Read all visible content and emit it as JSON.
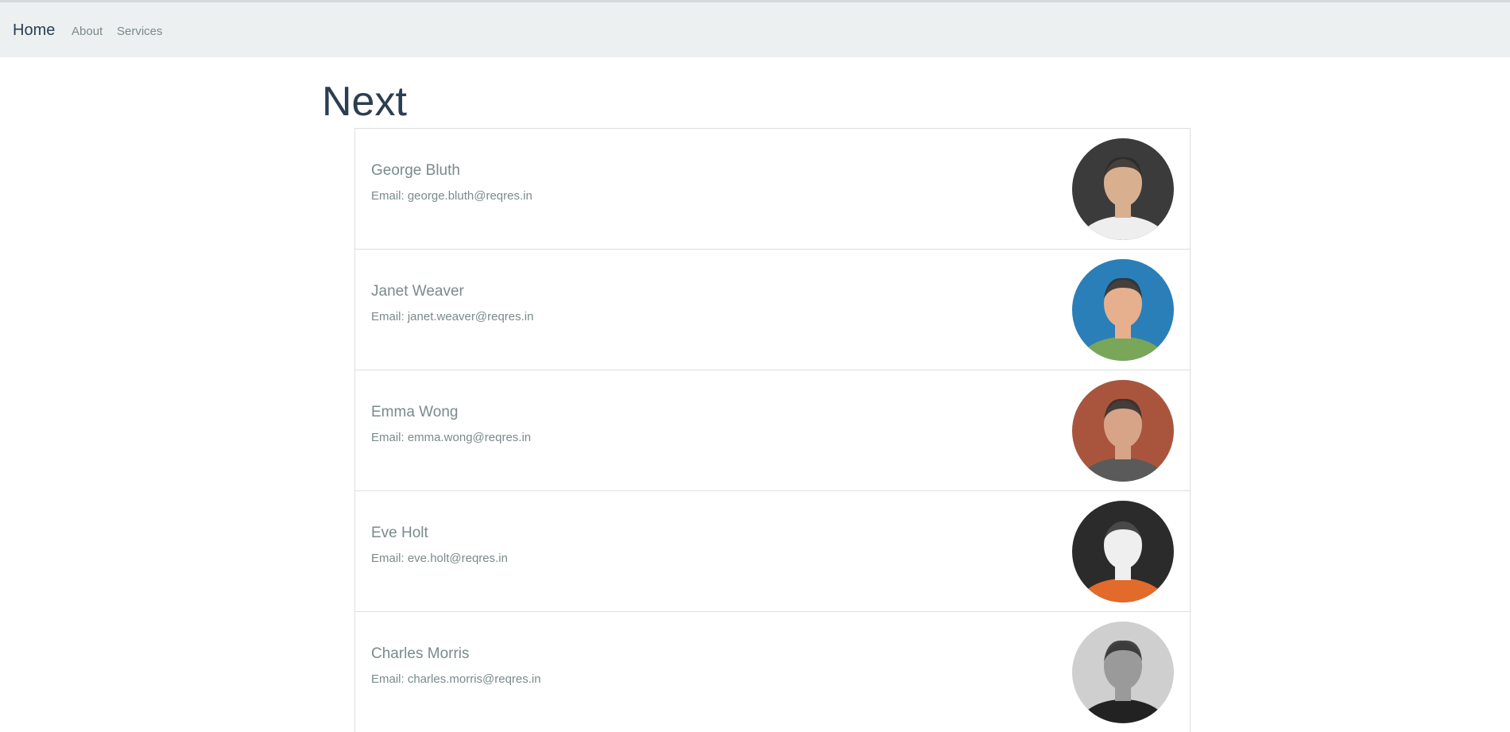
{
  "nav": {
    "brand": "Home",
    "links": [
      "About",
      "Services"
    ]
  },
  "page": {
    "title": "Next"
  },
  "users": [
    {
      "name": "George Bluth",
      "email": "Email: george.bluth@reqres.in",
      "avatar": "user-avatar-photo",
      "bg": "#3b3b3b",
      "skin": "#d9b08f",
      "shirt": "#eeeeee"
    },
    {
      "name": "Janet Weaver",
      "email": "Email: janet.weaver@reqres.in",
      "avatar": "user-avatar-photo",
      "bg": "#2a7fb8",
      "skin": "#e6b08e",
      "shirt": "#7aa65a"
    },
    {
      "name": "Emma Wong",
      "email": "Email: emma.wong@reqres.in",
      "avatar": "user-avatar-photo",
      "bg": "#a9553d",
      "skin": "#d7a488",
      "shirt": "#5a5a5a"
    },
    {
      "name": "Eve Holt",
      "email": "Email: eve.holt@reqres.in",
      "avatar": "user-avatar-photo",
      "bg": "#2b2b2b",
      "skin": "#efefef",
      "shirt": "#e26a2b"
    },
    {
      "name": "Charles Morris",
      "email": "Email: charles.morris@reqres.in",
      "avatar": "user-avatar-photo",
      "bg": "#cfcfcf",
      "skin": "#9a9a9a",
      "shirt": "#222222"
    }
  ]
}
